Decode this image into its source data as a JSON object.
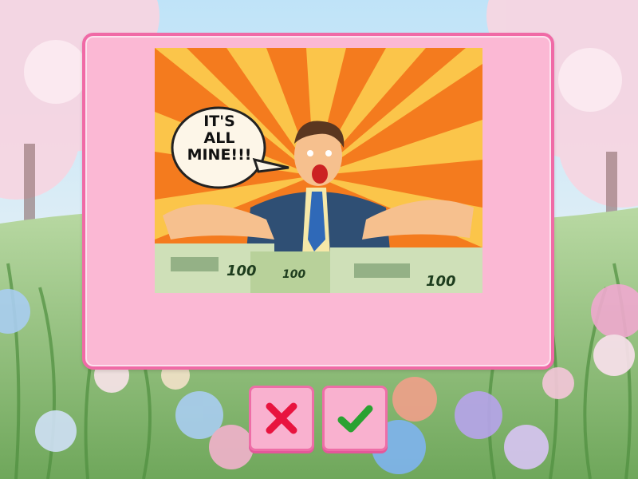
{
  "scene": {
    "background": "flower-meadow",
    "card_color": "#fbb8d4",
    "card_border_color": "#f06aa6"
  },
  "picture": {
    "bubble_text": "IT'S\nALL\nMINE!!!",
    "banknote_label": "100"
  },
  "buttons": {
    "wrong": {
      "icon": "cross-icon",
      "color": "#e8143f"
    },
    "right": {
      "icon": "check-icon",
      "color": "#2aa232"
    }
  }
}
